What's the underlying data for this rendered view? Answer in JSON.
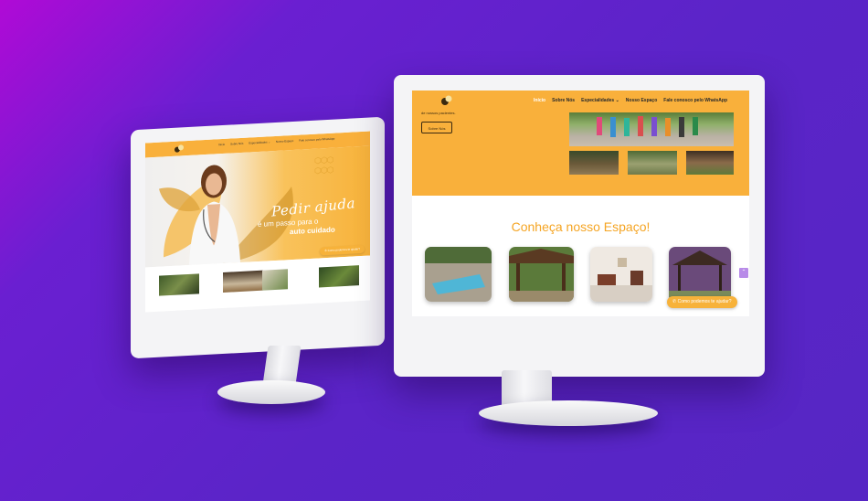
{
  "left_site": {
    "menu": [
      "Início",
      "Sobre Nós",
      "Especialidades ⌄",
      "Nosso Espaço",
      "Fale conosco pelo WhatsApp"
    ],
    "hero_title": "Pedir ajuda",
    "hero_sub1": "é um passo para o",
    "hero_sub2": "auto cuidado",
    "whatsapp_label": "Como podemos te ajudar?"
  },
  "right_site": {
    "menu": [
      "Início",
      "Sobre Nós",
      "Especialidades ⌄",
      "Nosso Espaço",
      "Fale conosco pelo WhatsApp"
    ],
    "intro_text": "de nossos pacientes.",
    "about_button": "Sobre Nós",
    "section_heading": "Conheça nosso Espaço!",
    "scroll_glyph": "⌃",
    "whatsapp_label": "Como podemos te ajudar?"
  },
  "colors": {
    "brand_orange": "#f9b03b",
    "heading_orange": "#f5a524",
    "background_purple": "#5b24c8",
    "background_magenta": "#b00ad6"
  }
}
